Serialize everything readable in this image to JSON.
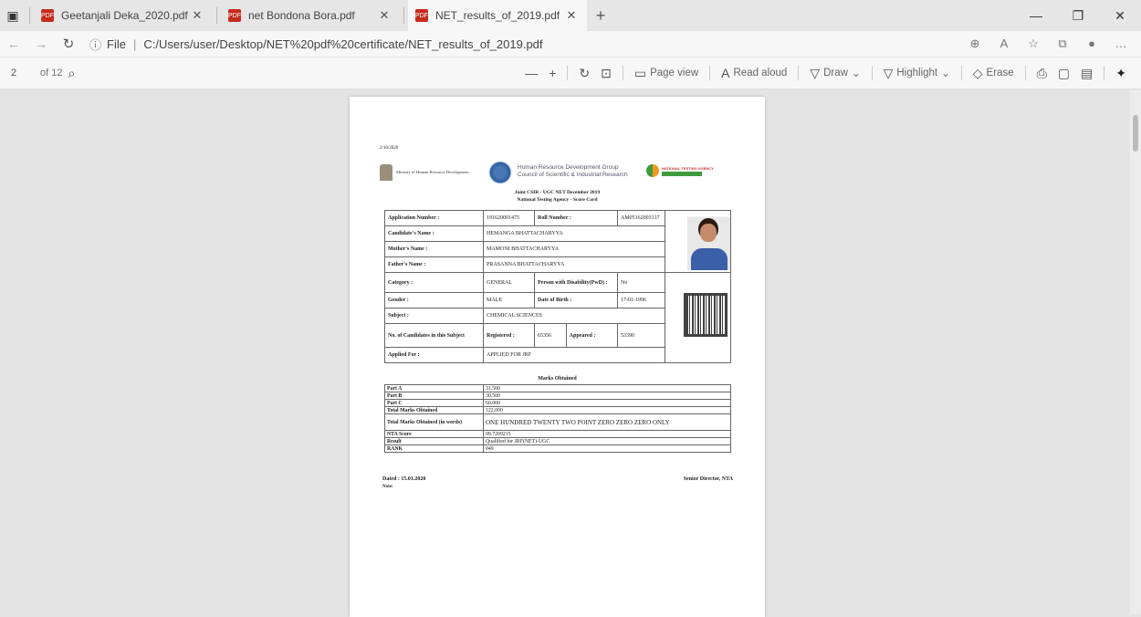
{
  "browser": {
    "tabs": [
      {
        "title": "Geetanjali Deka_2020.pdf"
      },
      {
        "title": "net Bondona Bora.pdf"
      },
      {
        "title": "NET_results_of_2019.pdf"
      }
    ],
    "address": {
      "scheme": "File",
      "path": "C:/Users/user/Desktop/NET%20pdf%20certificate/NET_results_of_2019.pdf"
    }
  },
  "pdf_toolbar": {
    "page": "2",
    "of": "of 12",
    "page_view": "Page view",
    "read_aloud": "Read aloud",
    "draw": "Draw",
    "highlight": "Highlight",
    "erase": "Erase"
  },
  "doc": {
    "date": "2/16/2020",
    "moe": "Ministry of Human Resource Development",
    "hrdg_line1": "Human Resource Development Group",
    "hrdg_line2": "Council of Scientific & Industrial Research",
    "nta": "NATIONAL TESTING AGENCY",
    "heading1": "Joint CSIR - UGC NET December 2019",
    "heading2": "National Testing Agency - Score Card",
    "application_label": "Application Number :",
    "application": "191620001475",
    "roll_label": "Roll Number :",
    "roll": "AM05162003137",
    "candidate_label": "Candidate's Name :",
    "candidate": "HEMANGA BHATTACHARYYA",
    "mother_label": "Mother's Name :",
    "mother": "MAMONI BHATTACHARYYA",
    "father_label": "Father's Name :",
    "father": "PRASANNA BHATTACHARYYA",
    "category_label": "Category :",
    "category": "GENERAL",
    "pwd_label": "Person with Disability(PwD) :",
    "pwd": "No",
    "gender_label": "Gender :",
    "gender": "MALE",
    "dob_label": "Date of Birth :",
    "dob": "17-01-1996",
    "subject_label": "Subject :",
    "subject": "CHEMICAL SCIENCES",
    "ncand_label": "No. of Candidates in this Subject",
    "registered_label": "Registered :",
    "registered": "65356",
    "appeared_label": "Appeared :",
    "appeared": "53390",
    "applied_label": "Applied For :",
    "applied": "APPLIED FOR JRF",
    "marks_heading": "Marks Obtained",
    "marks": [
      {
        "label": "Part A",
        "value": "31.500"
      },
      {
        "label": "Part B",
        "value": "30.500"
      },
      {
        "label": "Part C",
        "value": "60.000"
      },
      {
        "label": "Total Marks Obtained",
        "value": "122.000"
      },
      {
        "label": "Total Marks Obtained (in words)",
        "value": "ONE HUNDRED TWENTY TWO POINT ZERO ZERO ZERO ONLY"
      },
      {
        "label": "NTA Score",
        "value": "99.7209215"
      },
      {
        "label": "Result",
        "value": "Qualified for JRF(NET)-UGC"
      },
      {
        "label": "RANK",
        "value": "049"
      }
    ],
    "dated": "Dated : 15.01.2020",
    "director": "Senior Director, NTA",
    "note": "Note:"
  }
}
